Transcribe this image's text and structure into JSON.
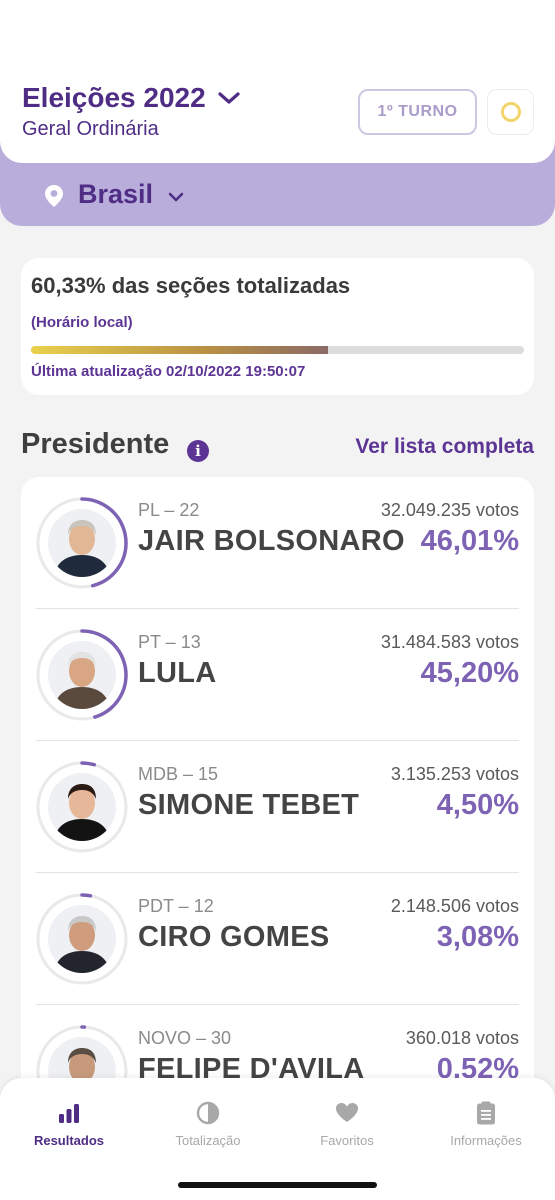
{
  "header": {
    "title": "Eleições 2022",
    "subtitle": "Geral Ordinária",
    "turno_label": "1º TURNO",
    "status_icon": "status-ring-icon"
  },
  "location": {
    "label": "Brasil",
    "icon": "location-pin-icon"
  },
  "progress": {
    "headline": "60,33% das seções totalizadas",
    "local_time_note": "(Horário local)",
    "fraction": 0.6033,
    "last_update": "Última atualização 02/10/2022 19:50:07"
  },
  "section": {
    "title": "Presidente",
    "info_icon": "info-icon",
    "full_list_label": "Ver lista completa"
  },
  "candidates": [
    {
      "party": "PL – 22",
      "name": "JAIR BOLSONARO",
      "votes": "32.049.235 votos",
      "percent": "46,01%",
      "share": 0.4601,
      "skin": "#e2b796",
      "hair": "#c9c4bd",
      "suit": "#1f2a3d"
    },
    {
      "party": "PT – 13",
      "name": "LULA",
      "votes": "31.484.583 votos",
      "percent": "45,20%",
      "share": 0.452,
      "skin": "#d9a684",
      "hair": "#e2e2e2",
      "suit": "#5a4a3e"
    },
    {
      "party": "MDB – 15",
      "name": "SIMONE TEBET",
      "votes": "3.135.253 votos",
      "percent": "4,50%",
      "share": 0.045,
      "skin": "#e6b899",
      "hair": "#2a1a14",
      "suit": "#131313"
    },
    {
      "party": "PDT – 12",
      "name": "CIRO GOMES",
      "votes": "2.148.506 votos",
      "percent": "3,08%",
      "share": 0.0308,
      "skin": "#cf9d7e",
      "hair": "#c8c8c8",
      "suit": "#22252e"
    },
    {
      "party": "NOVO – 30",
      "name": "FELIPE D'AVILA",
      "votes": "360.018 votos",
      "percent": "0,52%",
      "share": 0.0052,
      "skin": "#c89a7c",
      "hair": "#5a4d44",
      "suit": "#3a3f4a"
    }
  ],
  "nav": [
    {
      "label": "Resultados",
      "icon": "bar-chart-icon",
      "active": true
    },
    {
      "label": "Totalização",
      "icon": "pie-chart-icon",
      "active": false
    },
    {
      "label": "Favoritos",
      "icon": "heart-icon",
      "active": false
    },
    {
      "label": "Informações",
      "icon": "clipboard-icon",
      "active": false
    }
  ],
  "colors": {
    "brand": "#4f2d85",
    "accent": "#7e63b5",
    "band": "#b9addc",
    "status": "#f3d46a"
  }
}
